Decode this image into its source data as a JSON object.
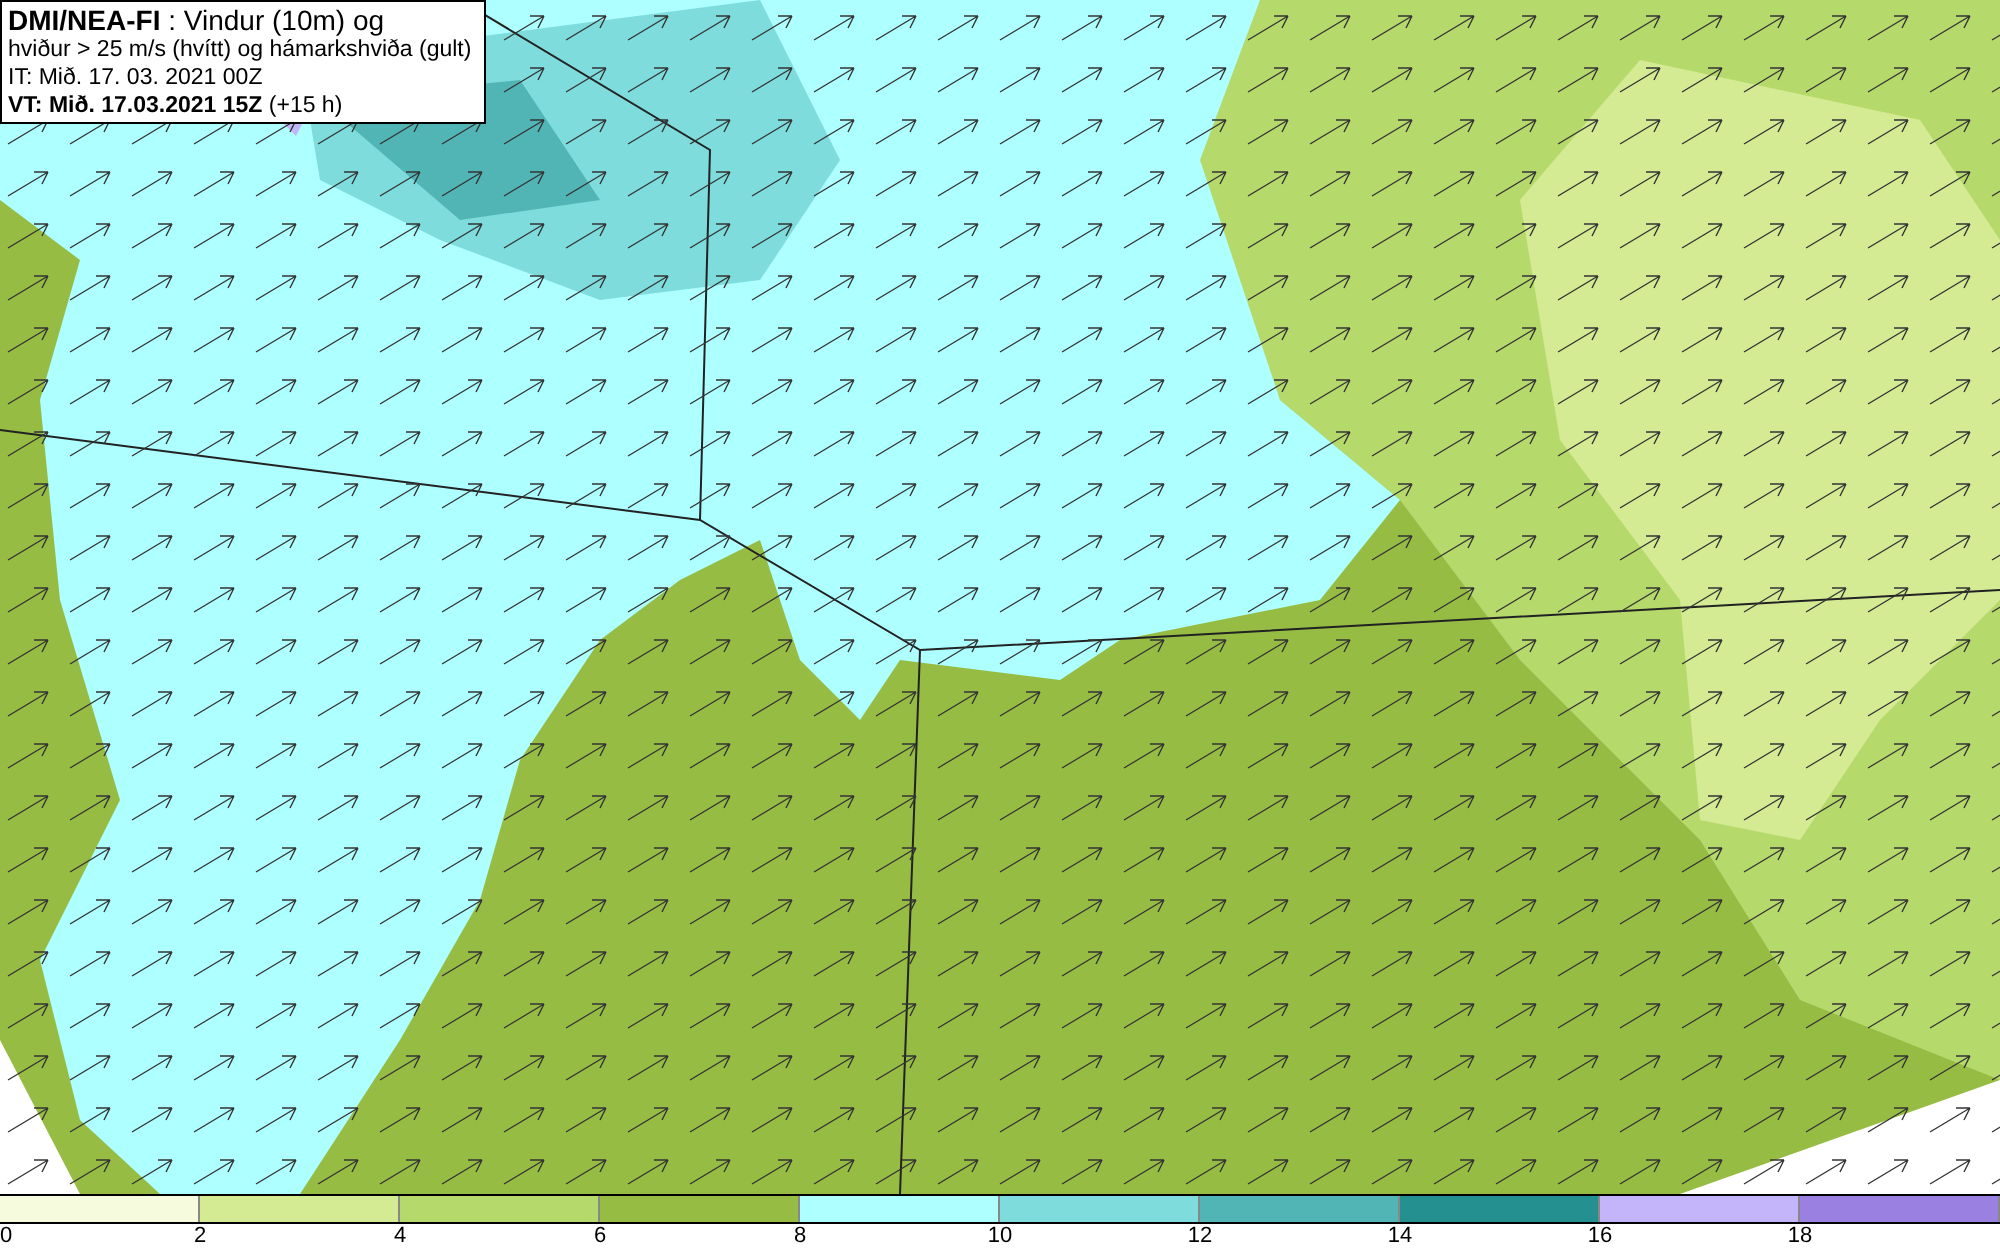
{
  "title_box": {
    "lines": [
      "**DMI/NEA-FI** : Vindur (10m) og",
      "hviður > 25 m/s (hvítt) og hámarkshviða (gult)",
      "IT: Mið. 17. 03. 2021 00Z",
      "**VT: Mið. 17.03.2021 15Z** (+15 h)"
    ]
  },
  "legend": {
    "segments": [
      {
        "color": "#f5fbdc"
      },
      {
        "color": "#d4eb94"
      },
      {
        "color": "#b6d96c"
      },
      {
        "color": "#96bc44"
      },
      {
        "color": "#aeffff"
      },
      {
        "color": "#7fdcdc"
      },
      {
        "color": "#52b5b5"
      },
      {
        "color": "#259090"
      },
      {
        "color": "#c4b4fa"
      },
      {
        "color": "#9a80e0"
      }
    ],
    "ticks": [
      "0",
      "2",
      "4",
      "6",
      "8",
      "10",
      "12",
      "14",
      "16",
      "18"
    ]
  }
}
